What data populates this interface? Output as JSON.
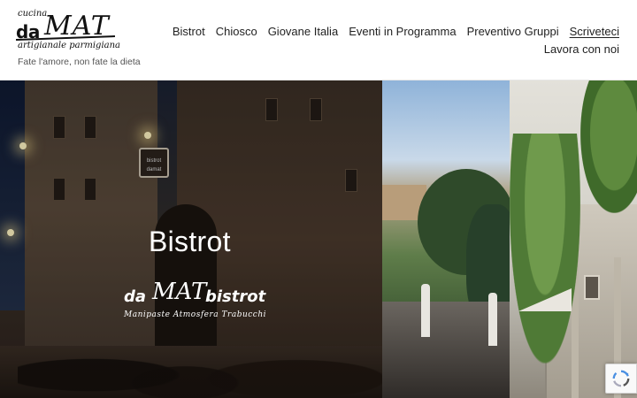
{
  "header": {
    "logo": {
      "top_word": "cucina",
      "main_da": "da",
      "main_mat": "MAT",
      "subtitle": "artigianale parmigiana"
    },
    "tagline": "Fate l'amore, non fate la dieta",
    "nav": {
      "row1": [
        "Bistrot",
        "Chiosco",
        "Giovane Italia",
        "Eventi in Programma",
        "Preventivo Gruppi",
        "Scriveteci"
      ],
      "row2": [
        "Lavora con noi"
      ],
      "active": "Scriveteci"
    }
  },
  "hero": {
    "title": "Bistrot",
    "brand": {
      "da": "da",
      "mat": "MAT",
      "bistrot": "bistrot",
      "subtitle": "Manipaste  Atmosfera  Trabucchi"
    },
    "sign_text": "bistrot damat"
  },
  "badges": {
    "recaptcha_icon": "recaptcha-icon"
  }
}
